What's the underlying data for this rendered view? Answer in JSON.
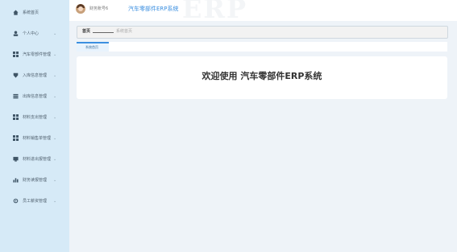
{
  "sidebar": {
    "items": [
      {
        "label": "系统首页",
        "icon": "home-icon",
        "chevron": ""
      },
      {
        "label": "个人中心",
        "icon": "user-icon",
        "chevron": "⌄"
      },
      {
        "label": "汽车零部件管理",
        "icon": "grid-icon",
        "chevron": "⌄"
      },
      {
        "label": "入库信息管理",
        "icon": "shield-icon",
        "chevron": "⌄"
      },
      {
        "label": "出库信息管理",
        "icon": "stack-icon",
        "chevron": "⌄"
      },
      {
        "label": "材料支出管理",
        "icon": "grid-icon",
        "chevron": "⌄"
      },
      {
        "label": "材料销售单管理",
        "icon": "grid-icon",
        "chevron": "⌄"
      },
      {
        "label": "材料进出报管理",
        "icon": "box-icon",
        "chevron": "⌄"
      },
      {
        "label": "财务读报管理",
        "icon": "bar-chart-icon",
        "chevron": "⌄"
      },
      {
        "label": "员工薪资管理",
        "icon": "gear-icon",
        "chevron": "⌄"
      }
    ]
  },
  "header": {
    "user_name": "财务账号6",
    "app_title": "汽车零部件ERP系统",
    "watermark": "ERP"
  },
  "breadcrumb": {
    "home": "首页",
    "current": "系统首页"
  },
  "tabs": [
    {
      "label": "系统首页"
    }
  ],
  "main": {
    "welcome": "欢迎使用 汽车零部件ERP系统"
  },
  "colors": {
    "sidebar_bg": "#d6eaf7",
    "accent": "#3b8fe0",
    "page_bg": "#eef3f8"
  }
}
